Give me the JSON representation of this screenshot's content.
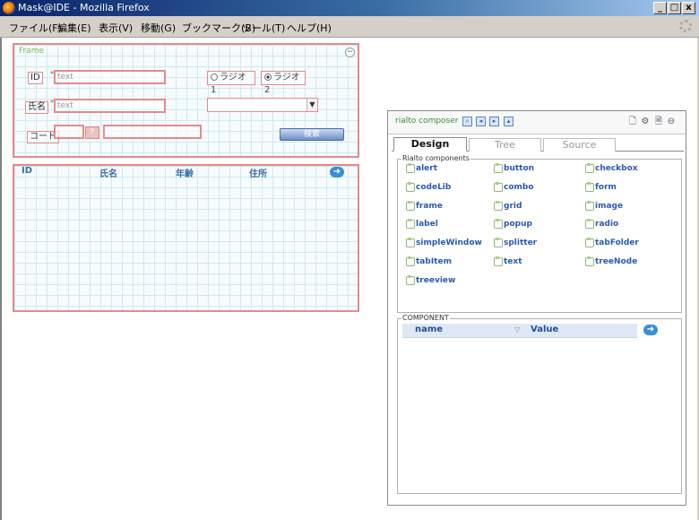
{
  "window": {
    "title": "Mask@IDE - Mozilla Firefox",
    "controls": [
      "_",
      "□",
      "x"
    ]
  },
  "menu": [
    "ファイル(F)",
    "編集(E)",
    "表示(V)",
    "移動(G)",
    "ブックマーク(B)",
    "ツール(T)",
    "ヘルプ(H)"
  ],
  "form": {
    "frame_title": "Frame",
    "id_label": "ID",
    "id_value": "text",
    "name_label": "氏名",
    "name_value": "text",
    "code_label": "コード",
    "radio1": "ラジオ1",
    "radio2": "ラジオ2",
    "help": "?",
    "search": "検索",
    "required_mark": "*"
  },
  "grid": {
    "columns": [
      "ID",
      "氏名",
      "年齢",
      "住所"
    ]
  },
  "composer": {
    "title": "rialto composer",
    "tabs": [
      "Design",
      "Tree",
      "Source"
    ],
    "components_legend": "Rialto components",
    "components": [
      "alert",
      "button",
      "checkbox",
      "codeLib",
      "combo",
      "form",
      "frame",
      "grid",
      "image",
      "label",
      "popup",
      "radio",
      "simpleWindow",
      "splitter",
      "tabFolder",
      "tabItem",
      "text",
      "treeNode",
      "treeview"
    ],
    "component_legend": "COMPONENT",
    "prop_name": "name",
    "prop_value": "Value"
  },
  "colors": {
    "accent_border": "#e58a8a",
    "grid_lines": "#cfe9f0",
    "link_blue": "#2a58b2",
    "title_bar": "#0a246a"
  }
}
